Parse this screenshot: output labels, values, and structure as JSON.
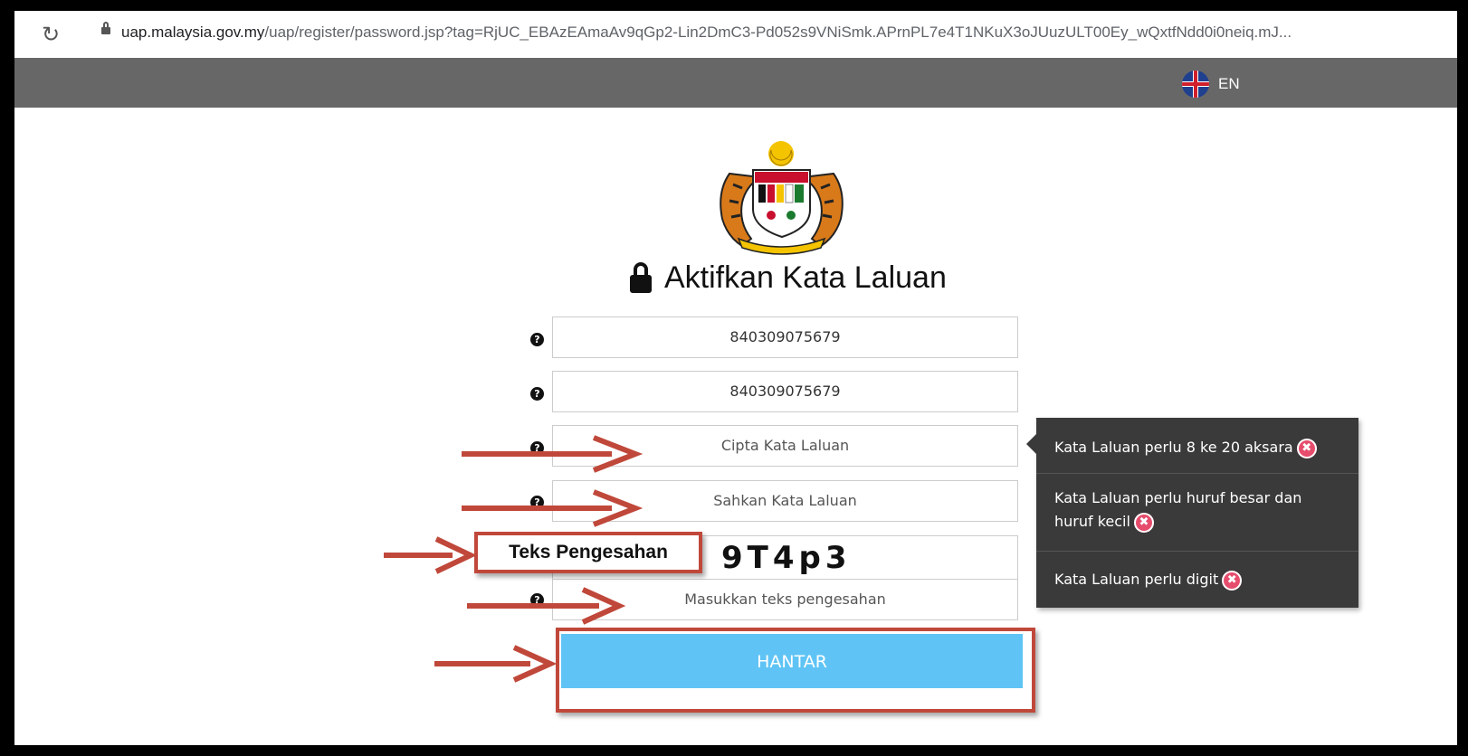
{
  "browser": {
    "url_host": "uap.malaysia.gov.my",
    "url_path": "/uap/register/password.jsp?tag=RjUC_EBAzEAmaAv9qGp2-Lin2DmC3-Pd052s9VNiSmk.APrnPL7e4T1NKuX3oJUuzULT00Ey_wQxtfNdd0i0neiq.mJ..."
  },
  "header": {
    "language": "EN"
  },
  "form": {
    "title": "Aktifkan Kata Laluan",
    "field1_value": "840309075679",
    "field2_value": "840309075679",
    "password_placeholder": "Cipta Kata Laluan",
    "confirm_placeholder": "Sahkan Kata Laluan",
    "captcha_code": "9T4p3",
    "captcha_input_placeholder": "Masukkan teks pengesahan",
    "submit_label": "HANTAR"
  },
  "annotation": {
    "captcha_callout": "Teks Pengesahan",
    "arrow_color": "#c0483a"
  },
  "tooltip": {
    "rule1": "Kata Laluan perlu 8 ke 20 aksara",
    "rule2": "Kata Laluan perlu huruf besar dan huruf kecil",
    "rule3": "Kata Laluan perlu digit"
  },
  "icons": {
    "help": "question-circle-icon",
    "error": "x-circle-icon",
    "lock": "padlock-icon",
    "flag": "uk-flag-icon"
  }
}
